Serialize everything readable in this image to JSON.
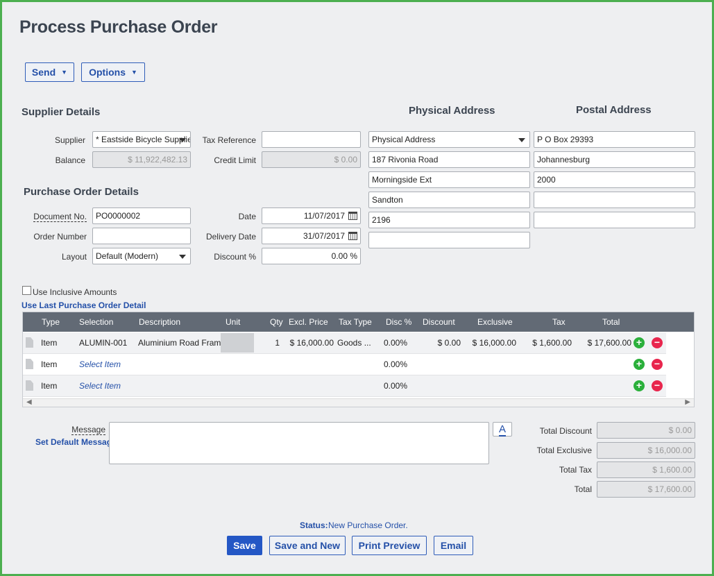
{
  "page": {
    "title": "Process Purchase Order"
  },
  "toolbar": {
    "send": "Send",
    "options": "Options"
  },
  "supplier": {
    "heading": "Supplier Details",
    "supplier_label": "Supplier",
    "supplier_value": "* Eastside Bicycle Supplie",
    "balance_label": "Balance",
    "balance_value": "$ 11,922,482.13",
    "tax_ref_label": "Tax Reference",
    "tax_ref_value": "",
    "credit_limit_label": "Credit Limit",
    "credit_limit_value": "$ 0.00"
  },
  "po": {
    "heading": "Purchase Order Details",
    "doc_no_label": "Document No.",
    "doc_no_value": "PO0000002",
    "order_no_label": "Order Number",
    "order_no_value": "",
    "layout_label": "Layout",
    "layout_value": "Default (Modern)",
    "date_label": "Date",
    "date_value": "11/07/2017",
    "delivery_label": "Delivery Date",
    "delivery_value": "31/07/2017",
    "discount_label": "Discount %",
    "discount_value": "0.00 %"
  },
  "physical": {
    "heading": "Physical Address",
    "select_value": "Physical Address",
    "lines": [
      "187 Rivonia Road",
      "Morningside Ext",
      "Sandton",
      "2196",
      ""
    ]
  },
  "postal": {
    "heading": "Postal Address",
    "lines": [
      "P O Box 29393",
      "Johannesburg",
      "2000",
      "",
      ""
    ]
  },
  "options": {
    "inclusive_label": "Use Inclusive Amounts",
    "use_last_link": "Use Last Purchase Order Detail"
  },
  "grid": {
    "headers": [
      "Type",
      "Selection",
      "Description",
      "Unit",
      "Qty",
      "Excl. Price",
      "Tax Type",
      "Disc %",
      "Discount",
      "Exclusive",
      "Tax",
      "Total"
    ],
    "rows": [
      {
        "type": "Item",
        "selection": "ALUMIN-001",
        "description": "Aluminium Road Frame",
        "qty": "1",
        "excl_price": "$ 16,000.00",
        "tax_type": "Goods ...",
        "disc_pct": "0.00%",
        "discount": "$ 0.00",
        "exclusive": "$ 16,000.00",
        "tax": "$ 1,600.00",
        "total": "$ 17,600.00"
      },
      {
        "type": "Item",
        "selection": "Select Item",
        "disc_pct": "0.00%"
      },
      {
        "type": "Item",
        "selection": "Select Item",
        "disc_pct": "0.00%"
      }
    ]
  },
  "message": {
    "label": "Message",
    "default_link": "Set Default Message",
    "value": "",
    "font_button": "A"
  },
  "totals": {
    "discount_label": "Total Discount",
    "discount_value": "$ 0.00",
    "exclusive_label": "Total Exclusive",
    "exclusive_value": "$ 16,000.00",
    "tax_label": "Total Tax",
    "tax_value": "$ 1,600.00",
    "total_label": "Total",
    "total_value": "$ 17,600.00"
  },
  "status": {
    "label": "Status:",
    "value": "New Purchase Order."
  },
  "actions": {
    "save": "Save",
    "save_new": "Save and New",
    "print_preview": "Print Preview",
    "email": "Email"
  }
}
